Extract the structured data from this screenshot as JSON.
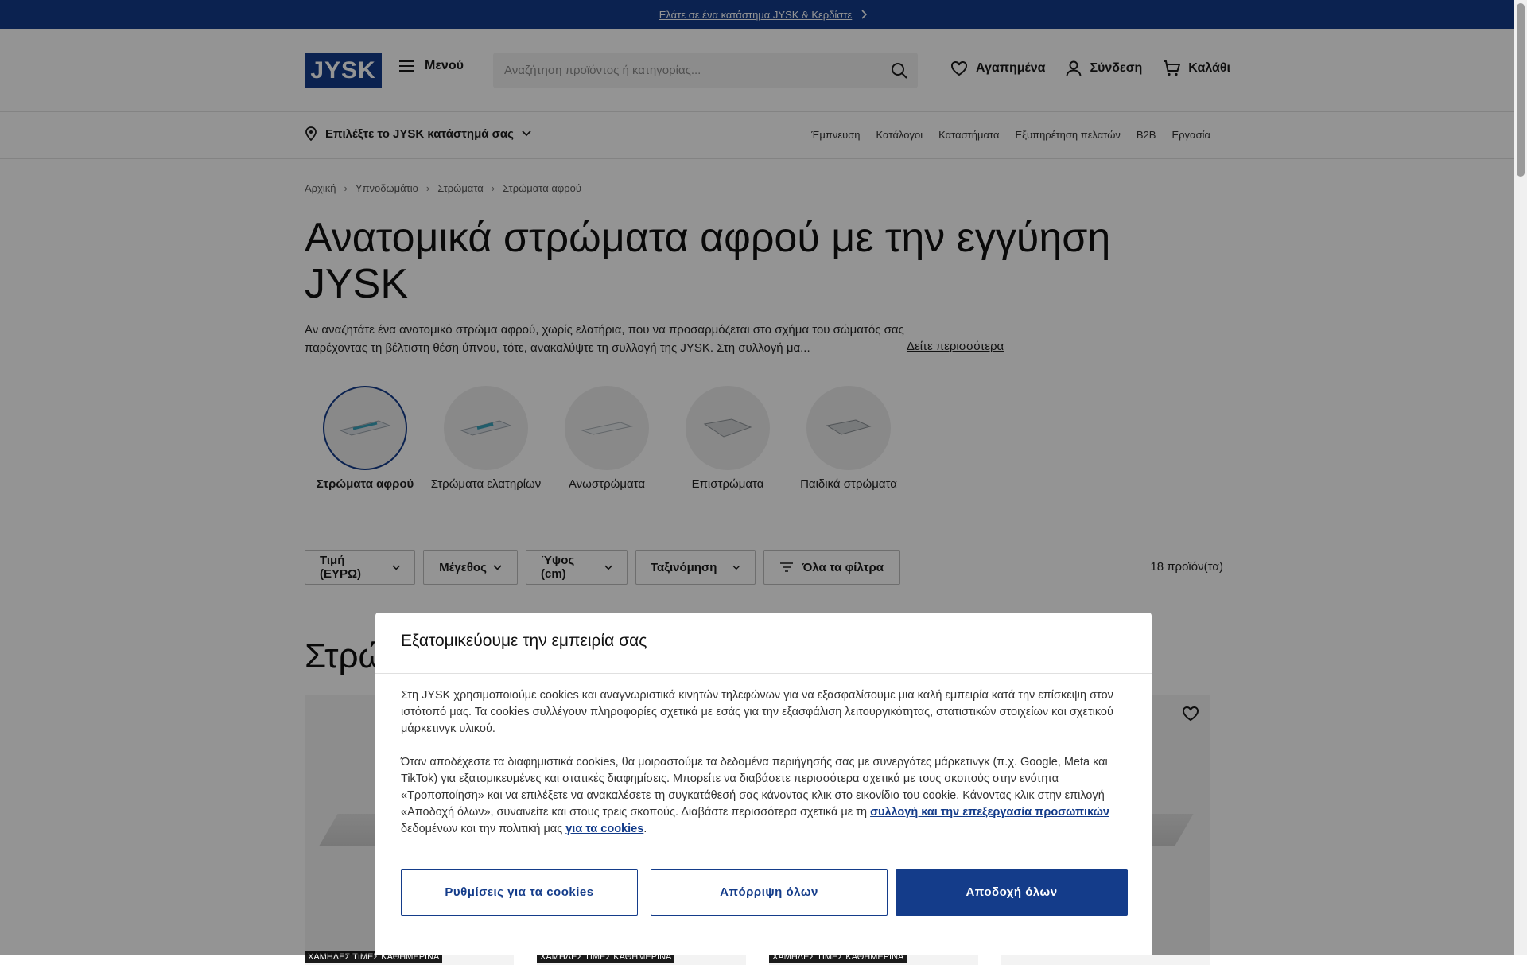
{
  "announcement": {
    "text": "Ελάτε σε ένα κατάστημα JYSK & Κερδίστε"
  },
  "header": {
    "logo_text": "JYSK",
    "menu_label": "Μενού",
    "search_placeholder": "Αναζήτηση προϊόντος ή κατηγορίας...",
    "favorites_label": "Αγαπημένα",
    "login_label": "Σύνδεση",
    "cart_label": "Καλάθι"
  },
  "subnav": {
    "store_select": "Επιλέξτε το JYSK κατάστημά σας",
    "links": [
      "Έμπνευση",
      "Κατάλογοι",
      "Καταστήματα",
      "Εξυπηρέτηση πελατών",
      "B2B",
      "Εργασία"
    ]
  },
  "breadcrumb": [
    "Αρχική",
    "Υπνοδωμάτιο",
    "Στρώματα",
    "Στρώματα αφρού"
  ],
  "page": {
    "title": "Ανατομικά στρώματα αφρού με την εγγύηση JYSK",
    "description": "Αν αναζητάτε ένα ανατομικό στρώμα αφρού, χωρίς ελατήρια, που να προσαρμόζεται στο σχήμα του σώματός σας παρέχοντας τη βέλτιστη θέση ύπνου, τότε, ανακαλύψτε τη συλλογή της JYSK. Στη συλλογή μα...",
    "more_link": "Δείτε περισσότερα",
    "section_title": "Στρώ"
  },
  "categories": [
    {
      "label": "Στρώματα αφρού",
      "active": true
    },
    {
      "label": "Στρώματα ελατηρίων",
      "active": false
    },
    {
      "label": "Ανωστρώματα",
      "active": false
    },
    {
      "label": "Επιστρώματα",
      "active": false
    },
    {
      "label": "Παιδικά στρώματα",
      "active": false
    }
  ],
  "filters": {
    "price": "Τιμή (ΕΥΡΩ)",
    "size": "Μέγεθος",
    "height": "Ύψος (cm)",
    "sort": "Ταξινόμηση",
    "all": "Όλα τα φίλτρα",
    "count": "18 προϊόν(τα)"
  },
  "products": {
    "badge": "ΧΑΜΗΛΕΣ ΤΙΜΕΣ ΚΑΘΗΜΕΡΙΝΑ"
  },
  "cookie_modal": {
    "title": "Εξατομικεύουμε την εμπειρία σας",
    "para1": "Στη JYSK χρησιμοποιούμε cookies και αναγνωριστικά κινητών τηλεφώνων για να εξασφαλίσουμε μια καλή εμπειρία κατά την επίσκεψη στον ιστότοπό μας. Τα cookies συλλέγουν πληροφορίες σχετικά με εσάς για την εξασφάλιση λειτουργικότητας, στατιστικών στοιχείων και σχετικού μάρκετινγκ υλικού.",
    "para2_a": "Όταν αποδέχεστε τα διαφημιστικά cookies, θα μοιραστούμε τα δεδομένα περιήγησής σας με συνεργάτες μάρκετινγκ (π.χ. Google, Meta και TikTok) για εξατομικευμένες και στατικές διαφημίσεις. Μπορείτε να διαβάσετε περισσότερα σχετικά με τους σκοπούς στην ενότητα «Τροποποίηση» και να επιλέξετε να ανακαλέσετε τη συγκατάθεσή σας κάνοντας κλικ στο εικονίδιο του cookie. Κάνοντας κλικ στην επιλογή «Αποδοχή όλων», συναινείτε και στους τρεις σκοπούς. Διαβάστε περισσότερα σχετικά με τη ",
    "link1": "συλλογή και την επεξεργασία προσωπικών",
    "para2_b": " δεδομένων και την πολιτική μας ",
    "link2": "για τα cookies",
    "para2_c": ".",
    "btn_settings": "Ρυθμίσεις για τα cookies",
    "btn_reject": "Απόρριψη όλων",
    "btn_accept": "Αποδοχή όλων"
  },
  "colors": {
    "brand": "#143c8a",
    "overlay": "rgba(0,0,0,0.42)"
  }
}
